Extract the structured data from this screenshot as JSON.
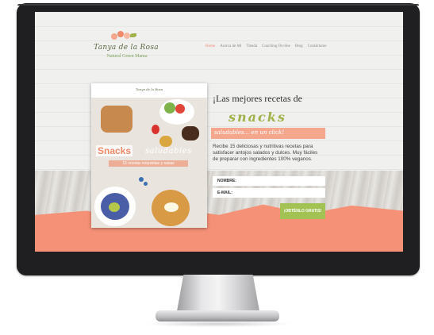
{
  "site": {
    "logo_name": "Tanya de la Rosa",
    "logo_tagline": "Natural Green Mama"
  },
  "nav": {
    "items": [
      {
        "label": "Home",
        "active": true
      },
      {
        "label": "Acerca de Mi",
        "active": false
      },
      {
        "label": "Tienda",
        "active": false
      },
      {
        "label": "Coaching On-line",
        "active": false
      },
      {
        "label": "Blog",
        "active": false
      },
      {
        "label": "Contáctame",
        "active": false
      }
    ]
  },
  "ebook": {
    "logo": "Tanya de la Rosa",
    "title_main": "Snacks",
    "title_script": "saludables",
    "subtitle": "15 recetas exquisitas y sanas"
  },
  "hero": {
    "headline": "¡Las mejores recetas de",
    "script_word": "snacks",
    "subhead": "saludables... en un click!",
    "description": "Recibe 15 deliciosas y nutritivas recetas para satisfacer antojos salados y dulces. Muy fáciles de preparar con ingredientes 100% veganos."
  },
  "form": {
    "name_label": "NOMBRE:",
    "email_label": "E-MAIL:",
    "submit_label": "¡OBTÉNLO GRATIS!"
  },
  "colors": {
    "accent_coral": "#f08a6b",
    "accent_green": "#a3c254",
    "monitor": "#1f1f21"
  }
}
